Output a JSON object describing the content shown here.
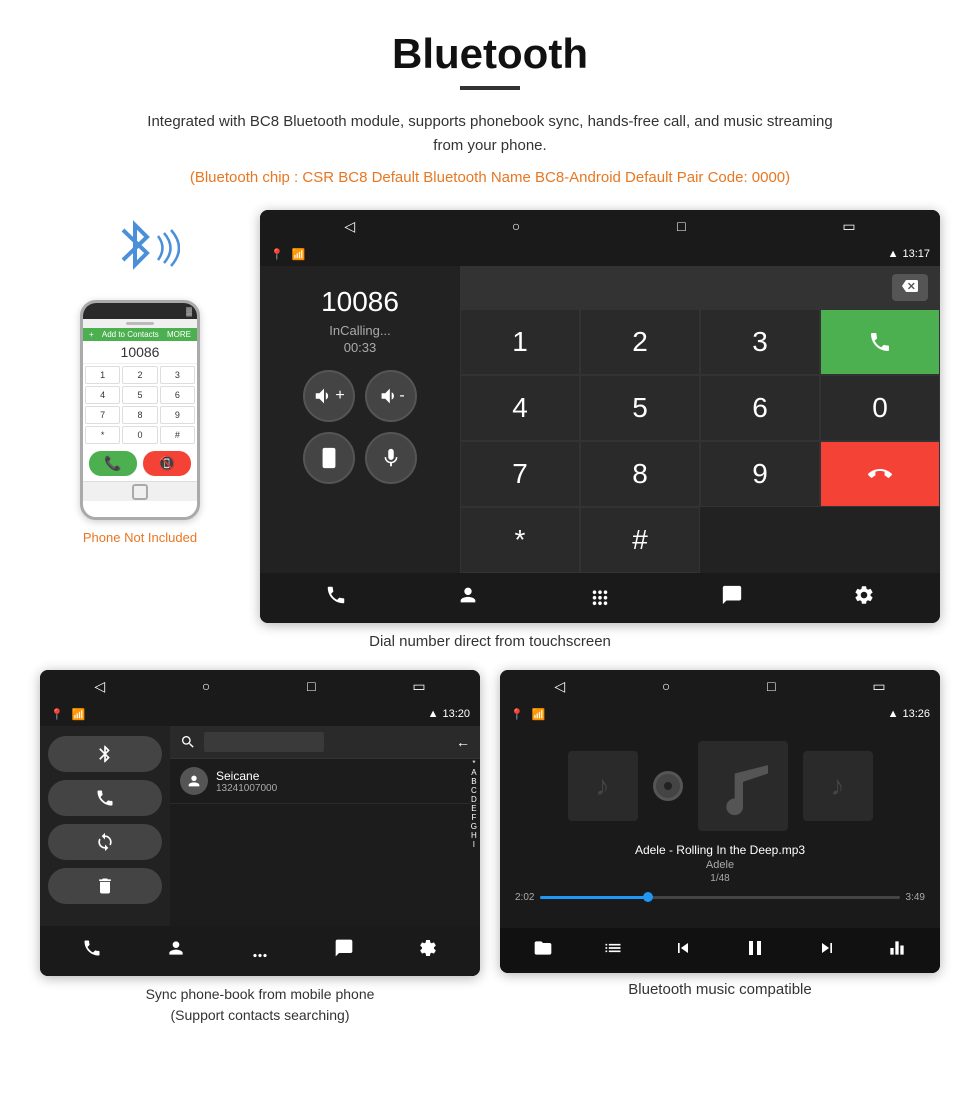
{
  "header": {
    "title": "Bluetooth",
    "description": "Integrated with BC8 Bluetooth module, supports phonebook sync, hands-free call, and music streaming from your phone.",
    "orange_text": "(Bluetooth chip : CSR BC8    Default Bluetooth Name BC8-Android    Default Pair Code: 0000)"
  },
  "dial_screen": {
    "status_time": "13:17",
    "dialed_number": "10086",
    "call_status": "InCalling...",
    "call_duration": "00:33",
    "keypad": [
      "1",
      "2",
      "3",
      "*",
      "4",
      "5",
      "6",
      "0",
      "7",
      "8",
      "9",
      "#"
    ],
    "caption": "Dial number direct from touchscreen"
  },
  "phonebook_screen": {
    "status_time": "13:20",
    "contact_name": "Seicane",
    "contact_number": "13241007000",
    "alpha_list": [
      "*",
      "A",
      "B",
      "C",
      "D",
      "E",
      "F",
      "G",
      "H",
      "I"
    ],
    "caption_line1": "Sync phone-book from mobile phone",
    "caption_line2": "(Support contacts searching)"
  },
  "music_screen": {
    "status_time": "13:26",
    "song_title": "Adele - Rolling In the Deep.mp3",
    "artist": "Adele",
    "track_count": "1/48",
    "time_current": "2:02",
    "time_total": "3:49",
    "progress_percent": 30,
    "caption": "Bluetooth music compatible"
  },
  "phone_mockup": {
    "not_included": "Phone Not Included"
  }
}
